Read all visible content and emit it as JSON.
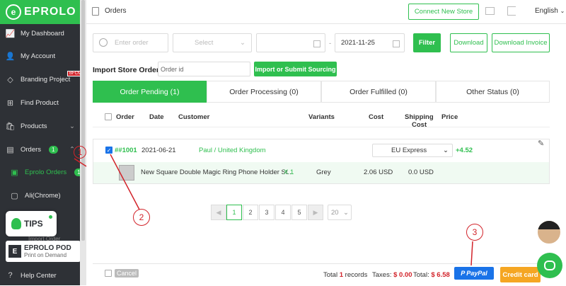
{
  "sidebar": {
    "brand": "EPROLO",
    "items": [
      {
        "label": "My Dashboard"
      },
      {
        "label": "My Account"
      },
      {
        "label": "Branding Project",
        "tag": "BFCM"
      },
      {
        "label": "Find Product"
      },
      {
        "label": "Products"
      },
      {
        "label": "Orders",
        "badge": "1"
      },
      {
        "label": "Eprolo Orders",
        "badge": "1"
      },
      {
        "label": "Ali(Chrome)"
      },
      {
        "label": "Help Center"
      }
    ],
    "partial_item": "Import Order",
    "tips_label": "TIPS",
    "pod_title": "EPROLO POD",
    "pod_subtitle": "Print on Demand"
  },
  "topbar": {
    "title": "Orders",
    "connect_store": "Connect New Store",
    "language": "English"
  },
  "filters": {
    "order_placeholder": "Enter order",
    "select_placeholder": "Select",
    "date_sep": "-",
    "end_date": "2021-11-25",
    "filter_btn": "Filter",
    "download_btn": "Download",
    "download_invoice_btn": "Download Invoice"
  },
  "import": {
    "label": "Import Store Order:",
    "placeholder": "Order id",
    "button": "Import or Submit Sourcing"
  },
  "tabs": [
    {
      "label": "Order Pending (1)"
    },
    {
      "label": "Order Processing (0)"
    },
    {
      "label": "Order Fulfilled (0)"
    },
    {
      "label": "Other Status (0)"
    }
  ],
  "table": {
    "headers": {
      "order": "Order",
      "date": "Date",
      "customer": "Customer",
      "variants": "Variants",
      "cost": "Cost",
      "shipping_1": "Shipping",
      "shipping_2": "Cost",
      "price": "Price"
    },
    "order": {
      "id": "##1001",
      "date": "2021-06-21",
      "customer": "Paul  / United Kingdom",
      "shipping_method": "EU Express",
      "shipping_extra": "+4.52"
    },
    "item": {
      "name": "New Square Double Magic Ring Phone Holder St...",
      "qty": "X 1",
      "variant": "Grey",
      "cost": "2.06 USD",
      "shipping": "0.0 USD"
    }
  },
  "pagination": {
    "pages": [
      "1",
      "2",
      "3",
      "4",
      "5"
    ],
    "page_size": "20"
  },
  "footer": {
    "cancel": "Cancel",
    "total_prefix": "Total",
    "total_count": "1",
    "total_suffix": "records",
    "taxes_label": "Taxes:",
    "taxes_value": "$ 0.00",
    "total_label": "Total:",
    "total_value": "$ 6.58",
    "paypal": "PayPal",
    "credit_card": "Credit card"
  },
  "annotations": [
    "1",
    "2",
    "3"
  ],
  "colors": {
    "brand_green": "#2fbf4f",
    "sidebar_bg": "#2e3136",
    "annotation_red": "#d2232a",
    "paypal_blue": "#1a73e8",
    "credit_orange": "#f5a623"
  }
}
